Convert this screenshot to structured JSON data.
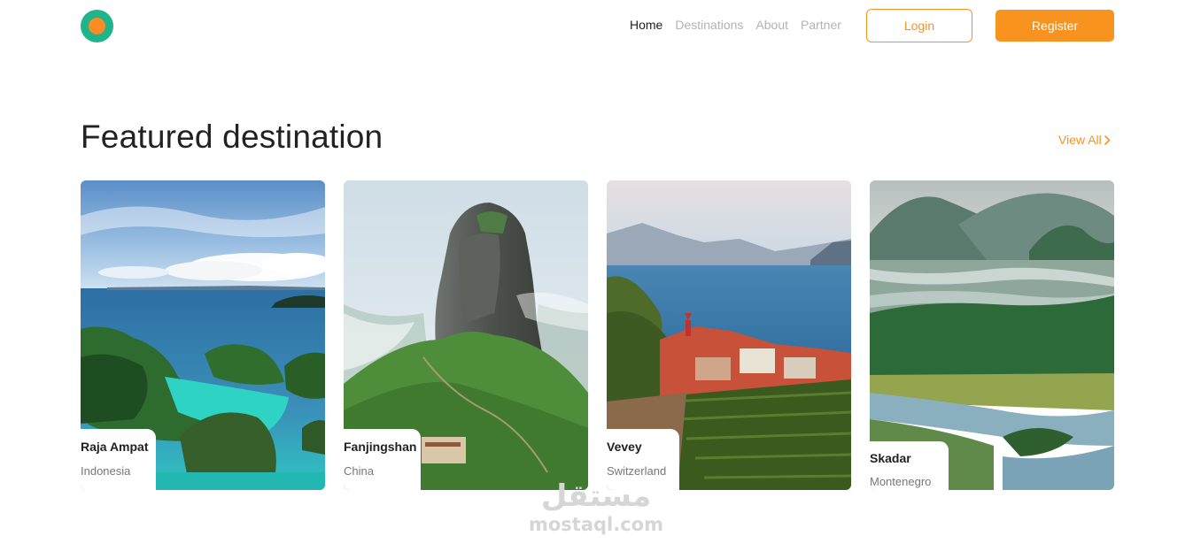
{
  "header": {
    "nav": [
      {
        "label": "Home",
        "active": true
      },
      {
        "label": "Destinations",
        "active": false
      },
      {
        "label": "About",
        "active": false
      },
      {
        "label": "Partner",
        "active": false
      }
    ],
    "login_label": "Login",
    "register_label": "Register"
  },
  "section": {
    "title": "Featured destination",
    "view_all": "View All",
    "view_all_icon": "chevron-right-icon"
  },
  "destinations": [
    {
      "name": "Raja Ampat",
      "country": "Indonesia"
    },
    {
      "name": "Fanjingshan",
      "country": "China"
    },
    {
      "name": "Vevey",
      "country": "Switzerland"
    },
    {
      "name": "Skadar",
      "country": "Montenegro"
    }
  ],
  "watermark": {
    "arabic": "مستقل",
    "latin": "mostaql.com"
  },
  "colors": {
    "accent": "#f7931e",
    "logo_outer": "#1fb489",
    "logo_inner": "#fa8b25",
    "nav_inactive": "#b3b3b3",
    "text_dark": "#1f1f1f"
  }
}
